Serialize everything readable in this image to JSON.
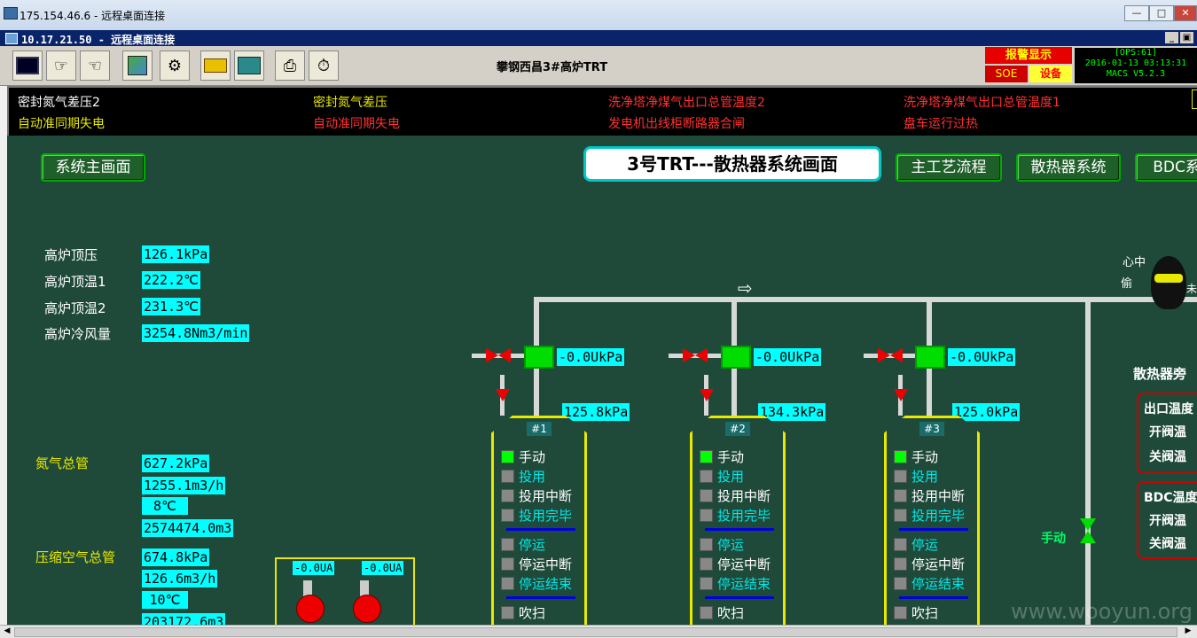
{
  "outer_window": {
    "title": "175.154.46.6 - 远程桌面连接",
    "minimize": "—",
    "maximize": "□",
    "close": "✕"
  },
  "inner_window": {
    "title": "10.17.21.50 - 远程桌面连接",
    "minimize": "_",
    "restore": "▣"
  },
  "toolbar": {
    "app_title": "攀钢西昌3#高炉TRT"
  },
  "alarm": {
    "title": "报警显示",
    "soe": "SOE",
    "equipment": "设备"
  },
  "status": {
    "ops": "[OPS:61]",
    "datetime": "2016-01-13 03:13:31",
    "version": "MACS V5.2.3"
  },
  "ticker": [
    {
      "text": "密封氮气差压2",
      "color": "#ffffff"
    },
    {
      "text": "密封氮气差压",
      "color": "#e8e800"
    },
    {
      "text": "洗净塔净煤气出口总管温度2",
      "color": "#ff3030"
    },
    {
      "text": "洗净塔净煤气出口总管温度1",
      "color": "#ff3030"
    },
    {
      "text": "自动准同期失电",
      "color": "#e8e800"
    },
    {
      "text": "自动准同期失电",
      "color": "#ff3030"
    },
    {
      "text": "发电机出线柜断路器合闸",
      "color": "#ff3030"
    },
    {
      "text": "盘车运行过热",
      "color": "#ff3030"
    }
  ],
  "nav": {
    "main": "系统主画面",
    "process": "主工艺流程",
    "radiator": "散热器系统",
    "bdc": "BDC系"
  },
  "screen_title": "3号TRT---散热器系统画面",
  "furnace": [
    {
      "label": "高炉顶压",
      "value": "126.1kPa"
    },
    {
      "label": "高炉顶温1",
      "value": "222.2℃"
    },
    {
      "label": "高炉顶温2",
      "value": "231.3℃"
    },
    {
      "label": "高炉冷风量",
      "value": "3254.8Nm3/min"
    }
  ],
  "nitrogen": {
    "label": "氮气总管",
    "values": [
      "627.2kPa",
      "1255.1m3/h",
      "8℃",
      "2574474.0m3"
    ]
  },
  "air": {
    "label": "压缩空气总管",
    "values": [
      "674.8kPa",
      "126.6m3/h",
      "10℃",
      "203172.6m3"
    ]
  },
  "compressors": [
    {
      "current": "-0.0UA"
    },
    {
      "current": "-0.0UA"
    }
  ],
  "units": [
    {
      "id": "#1",
      "line_pressure": "-0.0UkPa",
      "tank_pressure": "125.8kPa"
    },
    {
      "id": "#2",
      "line_pressure": "-0.0UkPa",
      "tank_pressure": "134.3kPa"
    },
    {
      "id": "#3",
      "line_pressure": "-0.0UkPa",
      "tank_pressure": "125.0kPa"
    }
  ],
  "states": {
    "manual": "手动",
    "in_use": "投用",
    "use_interrupt": "投用中断",
    "use_done": "投用完毕",
    "stop": "停运",
    "stop_interrupt": "停运中断",
    "stop_done": "停运结束",
    "purge": "吹扫"
  },
  "bypass_valve_label": "手动",
  "bypass": {
    "title": "散热器旁",
    "outlet_temp": "出口温度",
    "open_valve": "开阀温",
    "close_valve": "关阀温",
    "bdc_temp": "BDC温度",
    "open_valve2": "开阀温",
    "close_valve2": "关阀温"
  },
  "mascot": {
    "left": "心中",
    "right": "偷",
    "tail": "未"
  },
  "watermark": "www.wooyun.org"
}
